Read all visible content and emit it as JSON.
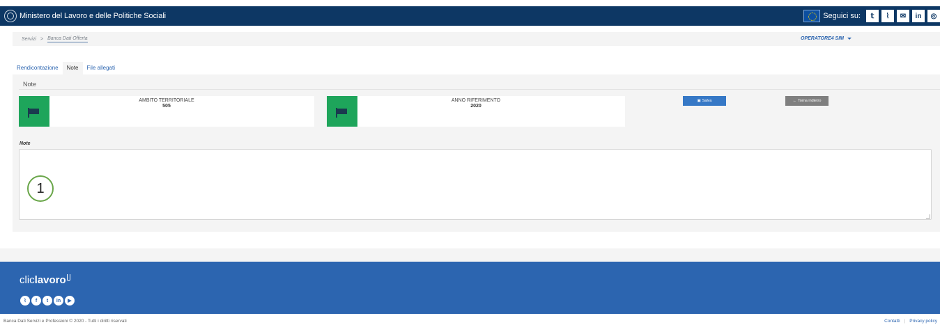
{
  "header": {
    "ministry": "Ministero del Lavoro e delle Politiche Sociali",
    "follow_label": "Seguici su:",
    "social": [
      "twitter",
      "rss",
      "email",
      "linkedin",
      "instagram"
    ],
    "social_glyphs": [
      "𝕥",
      "⌇",
      "✉",
      "in",
      "◎"
    ]
  },
  "breadcrumb": {
    "items": [
      "Servizi",
      "Banca Dati Offerta"
    ],
    "separator": ">"
  },
  "user": {
    "name": "OPERATORE4 SIM"
  },
  "tabs": [
    {
      "label": "Rendicontazione",
      "active": false
    },
    {
      "label": "Note",
      "active": true
    },
    {
      "label": "File allegati",
      "active": false
    }
  ],
  "panel": {
    "title": "Note",
    "cards": [
      {
        "label": "AMBITO TERRITORIALE",
        "value": "505"
      },
      {
        "label": "ANNO RIFERIMENTO",
        "value": "2020"
      }
    ],
    "save_label": "Salva",
    "back_label": "Torna indietro",
    "note_label": "Note",
    "note_value": "",
    "marker": "1"
  },
  "footer": {
    "logo_light": "clic",
    "logo_bold": "lavoro",
    "social": [
      "rss",
      "facebook",
      "twitter",
      "linkedin",
      "youtube"
    ],
    "social_glyphs": [
      "⌇",
      "f",
      "t",
      "in",
      "▶"
    ],
    "copyright": "Banca Dati Servizi e Professioni © 2020 - Tutti i diritti riservati",
    "links": [
      "Contatti",
      "Privacy policy"
    ]
  },
  "colors": {
    "header_bg": "#0d3764",
    "footer_bg": "#2c65b0",
    "card_icon": "#1ea55b",
    "save_button": "#3678c6",
    "back_button": "#7f7f7f"
  }
}
